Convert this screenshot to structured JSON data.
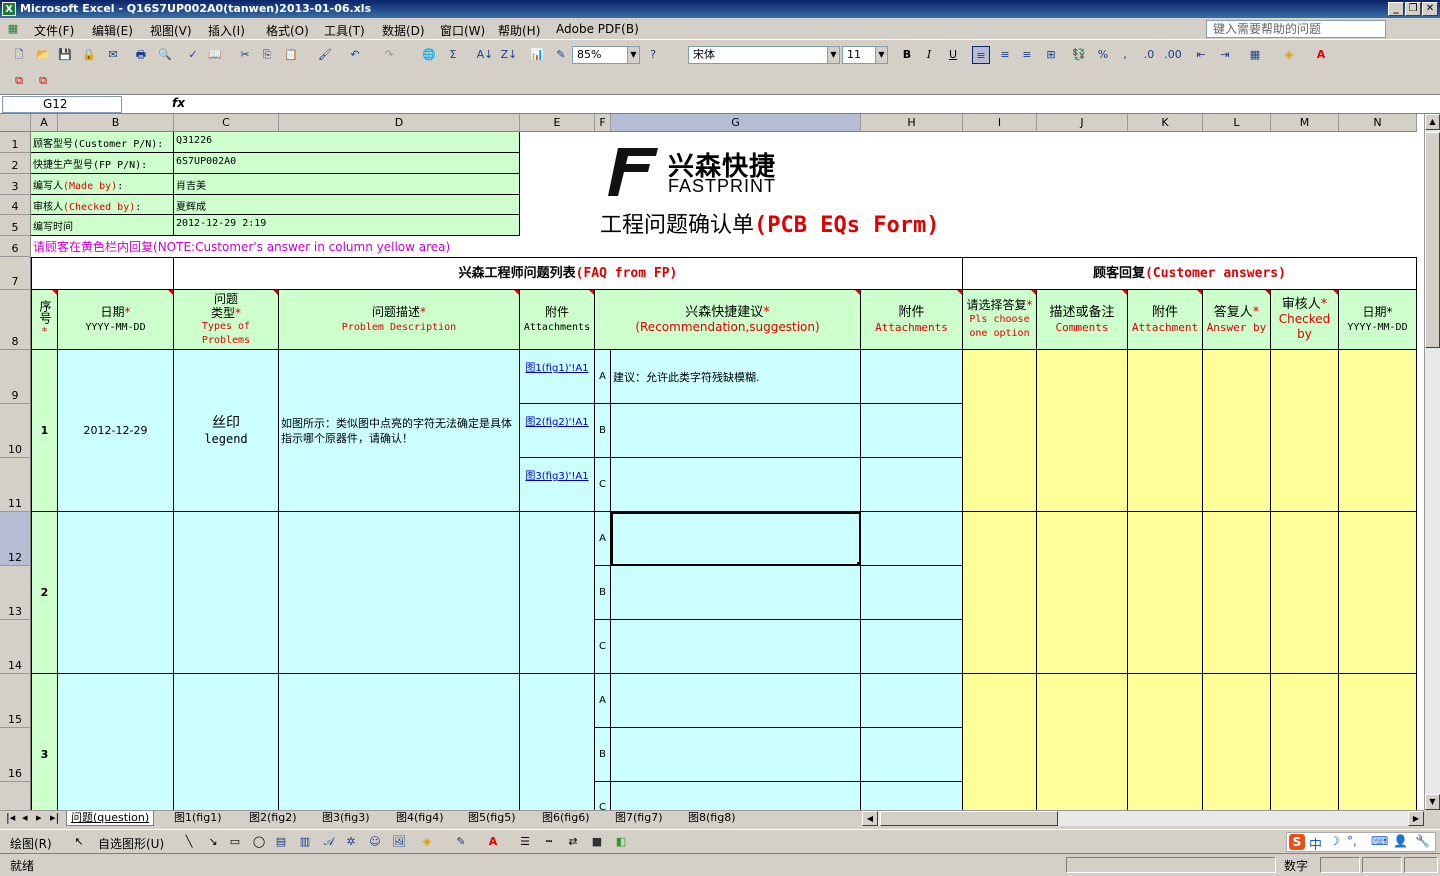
{
  "window": {
    "app": "Microsoft Excel",
    "title": "Microsoft Excel - Q16S7UP002A0(tanwen)2013-01-06.xls"
  },
  "menu": [
    "文件(F)",
    "编辑(E)",
    "视图(V)",
    "插入(I)",
    "格式(O)",
    "工具(T)",
    "数据(D)",
    "窗口(W)",
    "帮助(H)",
    "Adobe PDF(B)"
  ],
  "help_placeholder": "键入需要帮助的问题",
  "toolbar": {
    "zoom": "85%",
    "font": "宋体",
    "size": "11",
    "bold": "B",
    "italic": "I",
    "underline": "U"
  },
  "formula_bar": {
    "name_box": "G12",
    "fx": "fx",
    "value": ""
  },
  "columns": [
    "A",
    "B",
    "C",
    "D",
    "E",
    "F",
    "G",
    "H",
    "I",
    "J",
    "K",
    "L",
    "M",
    "N"
  ],
  "rows": [
    "1",
    "2",
    "3",
    "4",
    "5",
    "6",
    "7",
    "8",
    "9",
    "10",
    "11",
    "12",
    "13",
    "14",
    "15",
    "16"
  ],
  "info": {
    "customer_pn_label": "顾客型号(Customer P/N):",
    "customer_pn": "Q31226",
    "fp_pn_label": "快捷生产型号(FP P/N):",
    "fp_pn": "6S7UP002A0",
    "made_by_label_cn": "编写人",
    "made_by_label_en": "(Made by)",
    "made_by_colon": ":",
    "made_by": "肖吉美",
    "checked_by_label_cn": "审核人",
    "checked_by_label_en": "(Checked by)",
    "checked_by_colon": ":",
    "checked_by": "夏辉成",
    "time_label": "编写时间",
    "time": "2012-12-29 2:19",
    "note_cn": "请顾客在黄色栏内回复",
    "note_en": "(NOTE:Customer's answer in column yellow area)"
  },
  "logo": {
    "cn": "兴森快捷",
    "en": "FASTPRINT"
  },
  "form_title": {
    "cn": "工程问题确认单",
    "en": "(PCB EQs Form)"
  },
  "section": {
    "fp_cn": "兴森工程师问题列表",
    "fp_en": "(FAQ from FP)",
    "cust_cn": "顾客回复",
    "cust_en": "(Customer answers)"
  },
  "headers": {
    "seq": "序号",
    "seq_star": "*",
    "date": "日期",
    "date_star": "*",
    "date_fmt": "YYYY-MM-DD",
    "type": "问题类型",
    "type_star": "*",
    "type_en": "Types of Problems",
    "desc": "问题描述",
    "desc_star": "*",
    "desc_en": "Problem Description",
    "att": "附件",
    "att_en": "Attachments",
    "rec": "兴森快捷建议",
    "rec_star": "*",
    "rec_en": "(Recommendation,suggestion)",
    "att2": "附件",
    "att2_en": "Attachments",
    "choose": "请选择答复",
    "choose_star": "*",
    "choose_en": "Pls choose one option",
    "comm": "描述或备注",
    "comm_en": "Comments",
    "att3": "附件",
    "att3_en": "Attachment",
    "ansby": "答复人",
    "ansby_star": "*",
    "ansby_en": "Answer by",
    "chk": "审核人",
    "chk_star": "*",
    "chk_en": "Checked by",
    "date2": "日期*",
    "date2_fmt": "YYYY-MM-DD"
  },
  "questions": [
    {
      "no": "1",
      "date": "2012-12-29",
      "type_cn": "丝印",
      "type_en": "legend",
      "desc": "如图所示：类似图中点亮的字符无法确定是具体指示哪个原器件，请确认！",
      "links": [
        "图1(fig1)'!A1",
        "图2(fig2)'!A1",
        "图3(fig3)'!A1"
      ],
      "options": [
        "A",
        "B",
        "C"
      ],
      "suggestion": "建议：允许此类字符残缺模糊."
    },
    {
      "no": "2",
      "options": [
        "A",
        "B",
        "C"
      ]
    },
    {
      "no": "3",
      "options": [
        "A",
        "B",
        "C"
      ]
    }
  ],
  "sheet_tabs": [
    "问题(question)",
    "图1(fig1)",
    "图2(fig2)",
    "图3(fig3)",
    "图4(fig4)",
    "图5(fig5)",
    "图6(fig6)",
    "图7(fig7)",
    "图8(fig8)"
  ],
  "drawing": {
    "draw": "绘图(R)",
    "autoshape": "自选图形(U)"
  },
  "ime": {
    "s": "S",
    "zh": "中"
  },
  "status": {
    "left": "就绪",
    "right": "数字"
  }
}
